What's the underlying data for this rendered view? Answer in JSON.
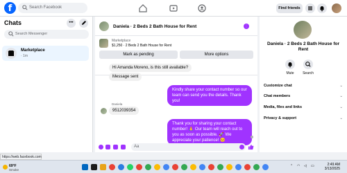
{
  "topbar": {
    "logo": "f",
    "search_placeholder": "Search Facebook",
    "find_friends": "Find friends"
  },
  "sidebar": {
    "title": "Chats",
    "search_placeholder": "Search Messenger",
    "items": [
      {
        "name": "Marketplace",
        "time": "· 1m"
      }
    ]
  },
  "status_url": "https://web.facebook.com",
  "chat": {
    "title": "Daniela · 2 Beds 2 Bath House for Rent",
    "listing_label": "Marketplace",
    "listing_price": "$1,250 · 2 Beds 2 Bath House for Rent",
    "mark_pending": "Mark as pending",
    "more_options": "More options",
    "messages": [
      {
        "dir": "in",
        "text": "Hi Amanda Moreno, is this still available?"
      },
      {
        "dir": "in",
        "text": "Message sent"
      },
      {
        "dir": "out",
        "text": "Kindly share your contact number so our team can send you the details. Thank you!"
      },
      {
        "dir": "in",
        "sender": "Daniela",
        "text": "9512039354"
      },
      {
        "dir": "out",
        "text": "Thank you for sharing your contact number! 🙏 Our team will reach out to you as soon as possible. 🚀 We appreciate your patience! 😊"
      }
    ],
    "composer_placeholder": "Aa"
  },
  "info_panel": {
    "title": "Daniela · 2 Beds 2 Bath House for Rent",
    "actions": [
      {
        "label": "Mute"
      },
      {
        "label": "Search"
      }
    ],
    "sections": [
      "Customize chat",
      "Chat members",
      "Media, files and links",
      "Privacy & support"
    ]
  },
  "taskbar": {
    "weather_temp": "69°F",
    "weather_desc": "Smoke",
    "time": "2:49 AM",
    "date": "3/13/2025"
  },
  "colors": {
    "facebook_blue": "#0866ff",
    "outgoing_bubble": "#a033ff",
    "incoming_bubble": "#f0f0f0",
    "selected_chat": "#ebf5ff"
  }
}
